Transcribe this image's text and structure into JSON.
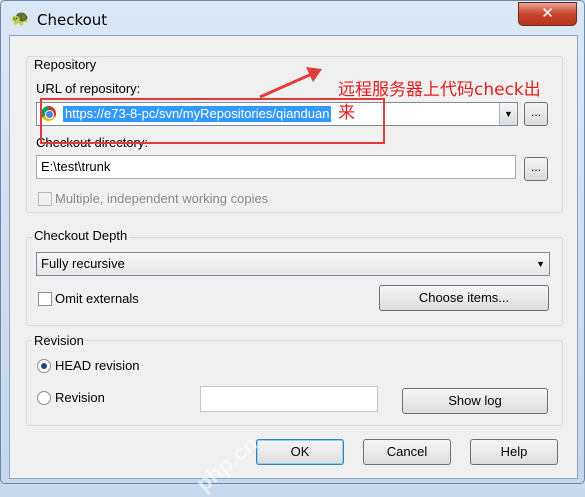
{
  "window": {
    "title": "Checkout",
    "close_label": "✕"
  },
  "repository": {
    "group_label": "Repository",
    "url_label": "URL of repository:",
    "url_value": "https://e73-8-pc/svn/myRepositories/qianduan",
    "checkout_dir_label": "Checkout directory:",
    "checkout_dir_value": "E:\\test\\trunk",
    "multiple_label": "Multiple, independent working copies",
    "browse_label": "..."
  },
  "depth": {
    "group_label": "Checkout Depth",
    "selected": "Fully recursive",
    "omit_externals_label": "Omit externals",
    "choose_items_label": "Choose items..."
  },
  "revision": {
    "group_label": "Revision",
    "head_label": "HEAD revision",
    "revision_label": "Revision",
    "show_log_label": "Show log"
  },
  "buttons": {
    "ok": "OK",
    "cancel": "Cancel",
    "help": "Help"
  },
  "annotation": {
    "text_line1": "远程服务器上代码check出",
    "text_line2": "来"
  },
  "watermark": "php.cn"
}
